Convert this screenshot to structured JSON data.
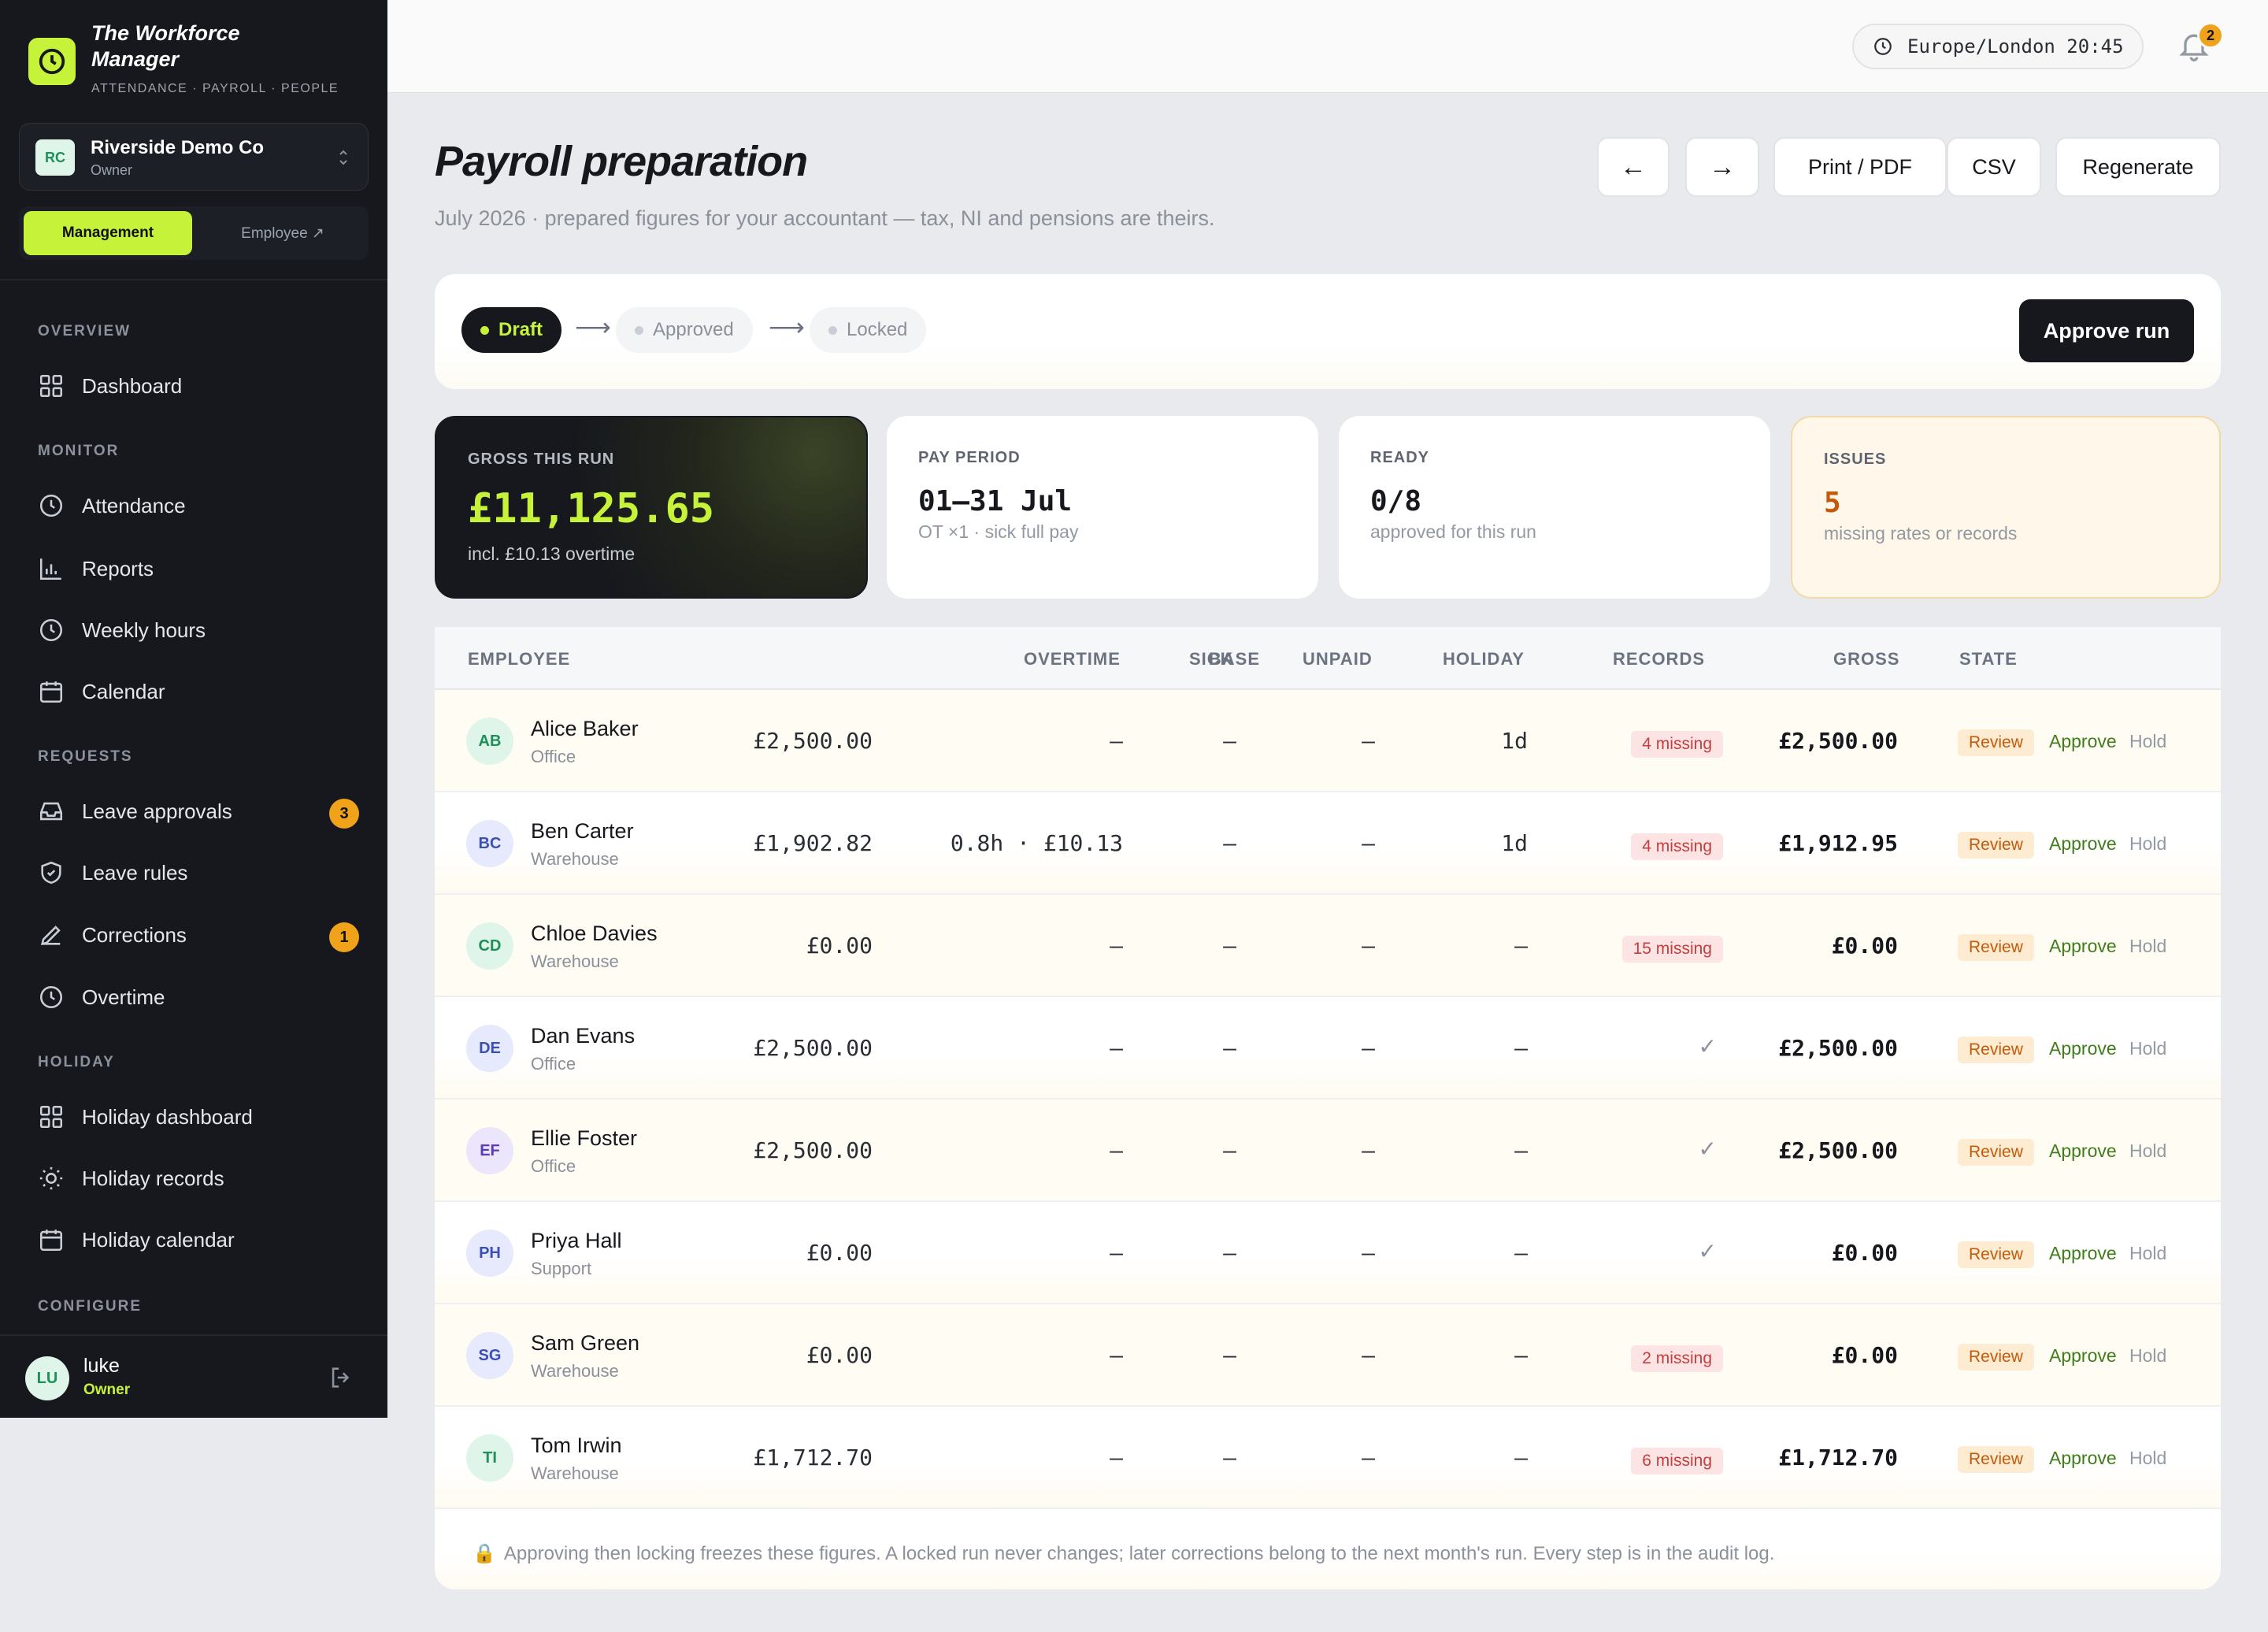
{
  "brand": {
    "title": "The Workforce Manager",
    "subtitle": "ATTENDANCE · PAYROLL · PEOPLE"
  },
  "org": {
    "initials": "RC",
    "name": "Riverside Demo Co",
    "role": "Owner"
  },
  "mode_switch": {
    "active": "Management",
    "inactive": "Employee ↗"
  },
  "nav": {
    "overview": {
      "label": "OVERVIEW",
      "items": [
        {
          "label": "Dashboard",
          "icon": "grid-icon"
        }
      ]
    },
    "monitor": {
      "label": "MONITOR",
      "items": [
        {
          "label": "Attendance",
          "icon": "clock-icon"
        },
        {
          "label": "Reports",
          "icon": "bar-chart-icon"
        },
        {
          "label": "Weekly hours",
          "icon": "clock-icon"
        },
        {
          "label": "Calendar",
          "icon": "calendar-icon"
        }
      ]
    },
    "requests": {
      "label": "REQUESTS",
      "items": [
        {
          "label": "Leave approvals",
          "icon": "inbox-icon",
          "badge": "3"
        },
        {
          "label": "Leave rules",
          "icon": "shield-icon"
        },
        {
          "label": "Corrections",
          "icon": "pencil-icon",
          "badge": "1"
        },
        {
          "label": "Overtime",
          "icon": "clock-icon"
        }
      ]
    },
    "holiday": {
      "label": "HOLIDAY",
      "items": [
        {
          "label": "Holiday dashboard",
          "icon": "grid-icon"
        },
        {
          "label": "Holiday records",
          "icon": "sun-icon"
        },
        {
          "label": "Holiday calendar",
          "icon": "calendar-icon"
        }
      ]
    },
    "configure": {
      "label": "CONFIGURE"
    }
  },
  "user": {
    "initials": "LU",
    "name": "luke",
    "role": "Owner"
  },
  "topbar": {
    "timezone": "Europe/London 20:45",
    "notifications": "2"
  },
  "page": {
    "title": "Payroll preparation",
    "subtitle": "July 2026 · prepared figures for your accountant — tax, NI and pensions are theirs.",
    "buttons": {
      "prev": "←",
      "next": "→",
      "print": "Print / PDF",
      "csv": "CSV",
      "regenerate": "Regenerate"
    }
  },
  "workflow": {
    "steps": [
      "Draft",
      "Approved",
      "Locked"
    ],
    "active_step": "Draft",
    "arrow": "⟶",
    "approve_label": "Approve run"
  },
  "cards": {
    "gross": {
      "label": "GROSS THIS RUN",
      "value": "£11,125.65",
      "note": "incl. £10.13 overtime"
    },
    "period": {
      "label": "PAY PERIOD",
      "value": "01–31 Jul",
      "note": "OT ×1 · sick full pay"
    },
    "ready": {
      "label": "READY",
      "value": "0/8",
      "note": "approved for this run"
    },
    "issues": {
      "label": "ISSUES",
      "value": "5",
      "note": "missing rates or records"
    }
  },
  "table": {
    "columns": {
      "employee": "EMPLOYEE",
      "base": "BASE",
      "overtime": "OVERTIME",
      "sick": "SICK",
      "unpaid": "UNPAID",
      "holiday": "HOLIDAY",
      "records": "RECORDS",
      "gross": "GROSS",
      "state": "STATE"
    },
    "actions": {
      "review": "Review",
      "approve": "Approve",
      "hold": "Hold"
    },
    "rows": [
      {
        "initials": "AB",
        "name": "Alice Baker",
        "dept": "Office",
        "base": "£2,500.00",
        "overtime": "–",
        "sick": "–",
        "unpaid": "–",
        "holiday": "1d",
        "records": "4 missing",
        "gross": "£2,500.00"
      },
      {
        "initials": "BC",
        "name": "Ben Carter",
        "dept": "Warehouse",
        "base": "£1,902.82",
        "overtime": "0.8h · £10.13",
        "sick": "–",
        "unpaid": "–",
        "holiday": "1d",
        "records": "4 missing",
        "gross": "£1,912.95"
      },
      {
        "initials": "CD",
        "name": "Chloe Davies",
        "dept": "Warehouse",
        "base": "£0.00",
        "overtime": "–",
        "sick": "–",
        "unpaid": "–",
        "holiday": "–",
        "records": "15 missing",
        "gross": "£0.00"
      },
      {
        "initials": "DE",
        "name": "Dan Evans",
        "dept": "Office",
        "base": "£2,500.00",
        "overtime": "–",
        "sick": "–",
        "unpaid": "–",
        "holiday": "–",
        "records": "✓",
        "gross": "£2,500.00"
      },
      {
        "initials": "EF",
        "name": "Ellie Foster",
        "dept": "Office",
        "base": "£2,500.00",
        "overtime": "–",
        "sick": "–",
        "unpaid": "–",
        "holiday": "–",
        "records": "✓",
        "gross": "£2,500.00"
      },
      {
        "initials": "PH",
        "name": "Priya Hall",
        "dept": "Support",
        "base": "£0.00",
        "overtime": "–",
        "sick": "–",
        "unpaid": "–",
        "holiday": "–",
        "records": "✓",
        "gross": "£0.00"
      },
      {
        "initials": "SG",
        "name": "Sam Green",
        "dept": "Warehouse",
        "base": "£0.00",
        "overtime": "–",
        "sick": "–",
        "unpaid": "–",
        "holiday": "–",
        "records": "2 missing",
        "gross": "£0.00"
      },
      {
        "initials": "TI",
        "name": "Tom Irwin",
        "dept": "Warehouse",
        "base": "£1,712.70",
        "overtime": "–",
        "sick": "–",
        "unpaid": "–",
        "holiday": "–",
        "records": "6 missing",
        "gross": "£1,712.70"
      }
    ],
    "footer": "Approving then locking freezes these figures. A locked run never changes; later corrections belong to the next month's run. Every step is in the audit log."
  },
  "colors": {
    "accent": "#c6f23a",
    "sidebar": "#16181d",
    "warning": "#f0a21a",
    "danger": "#c53d3d",
    "success": "#3f7d1a"
  }
}
